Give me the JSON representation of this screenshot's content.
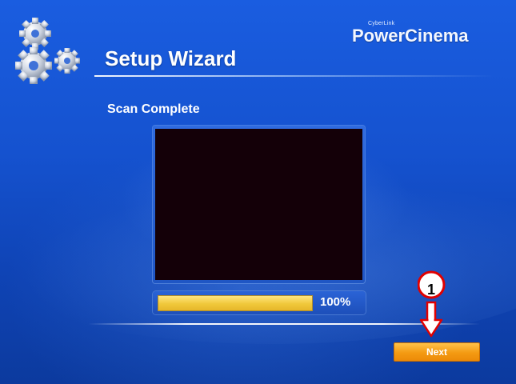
{
  "brand": {
    "small": "CyberLink",
    "main": "PowerCinema"
  },
  "wizard": {
    "title": "Setup Wizard",
    "section_title": "Scan Complete"
  },
  "progress": {
    "value": 1.0,
    "label": "100%"
  },
  "buttons": {
    "next_label": "Next"
  },
  "annotation": {
    "step_number": "1"
  },
  "icons": {
    "app_icon": "gears-icon",
    "callout_arrow": "down-arrow-icon"
  },
  "colors": {
    "background": "#1552cf",
    "progress_fill": "#f0c83a",
    "next_button": "#f49a12",
    "preview_screen": "#140008",
    "annotation": "#e00000"
  }
}
